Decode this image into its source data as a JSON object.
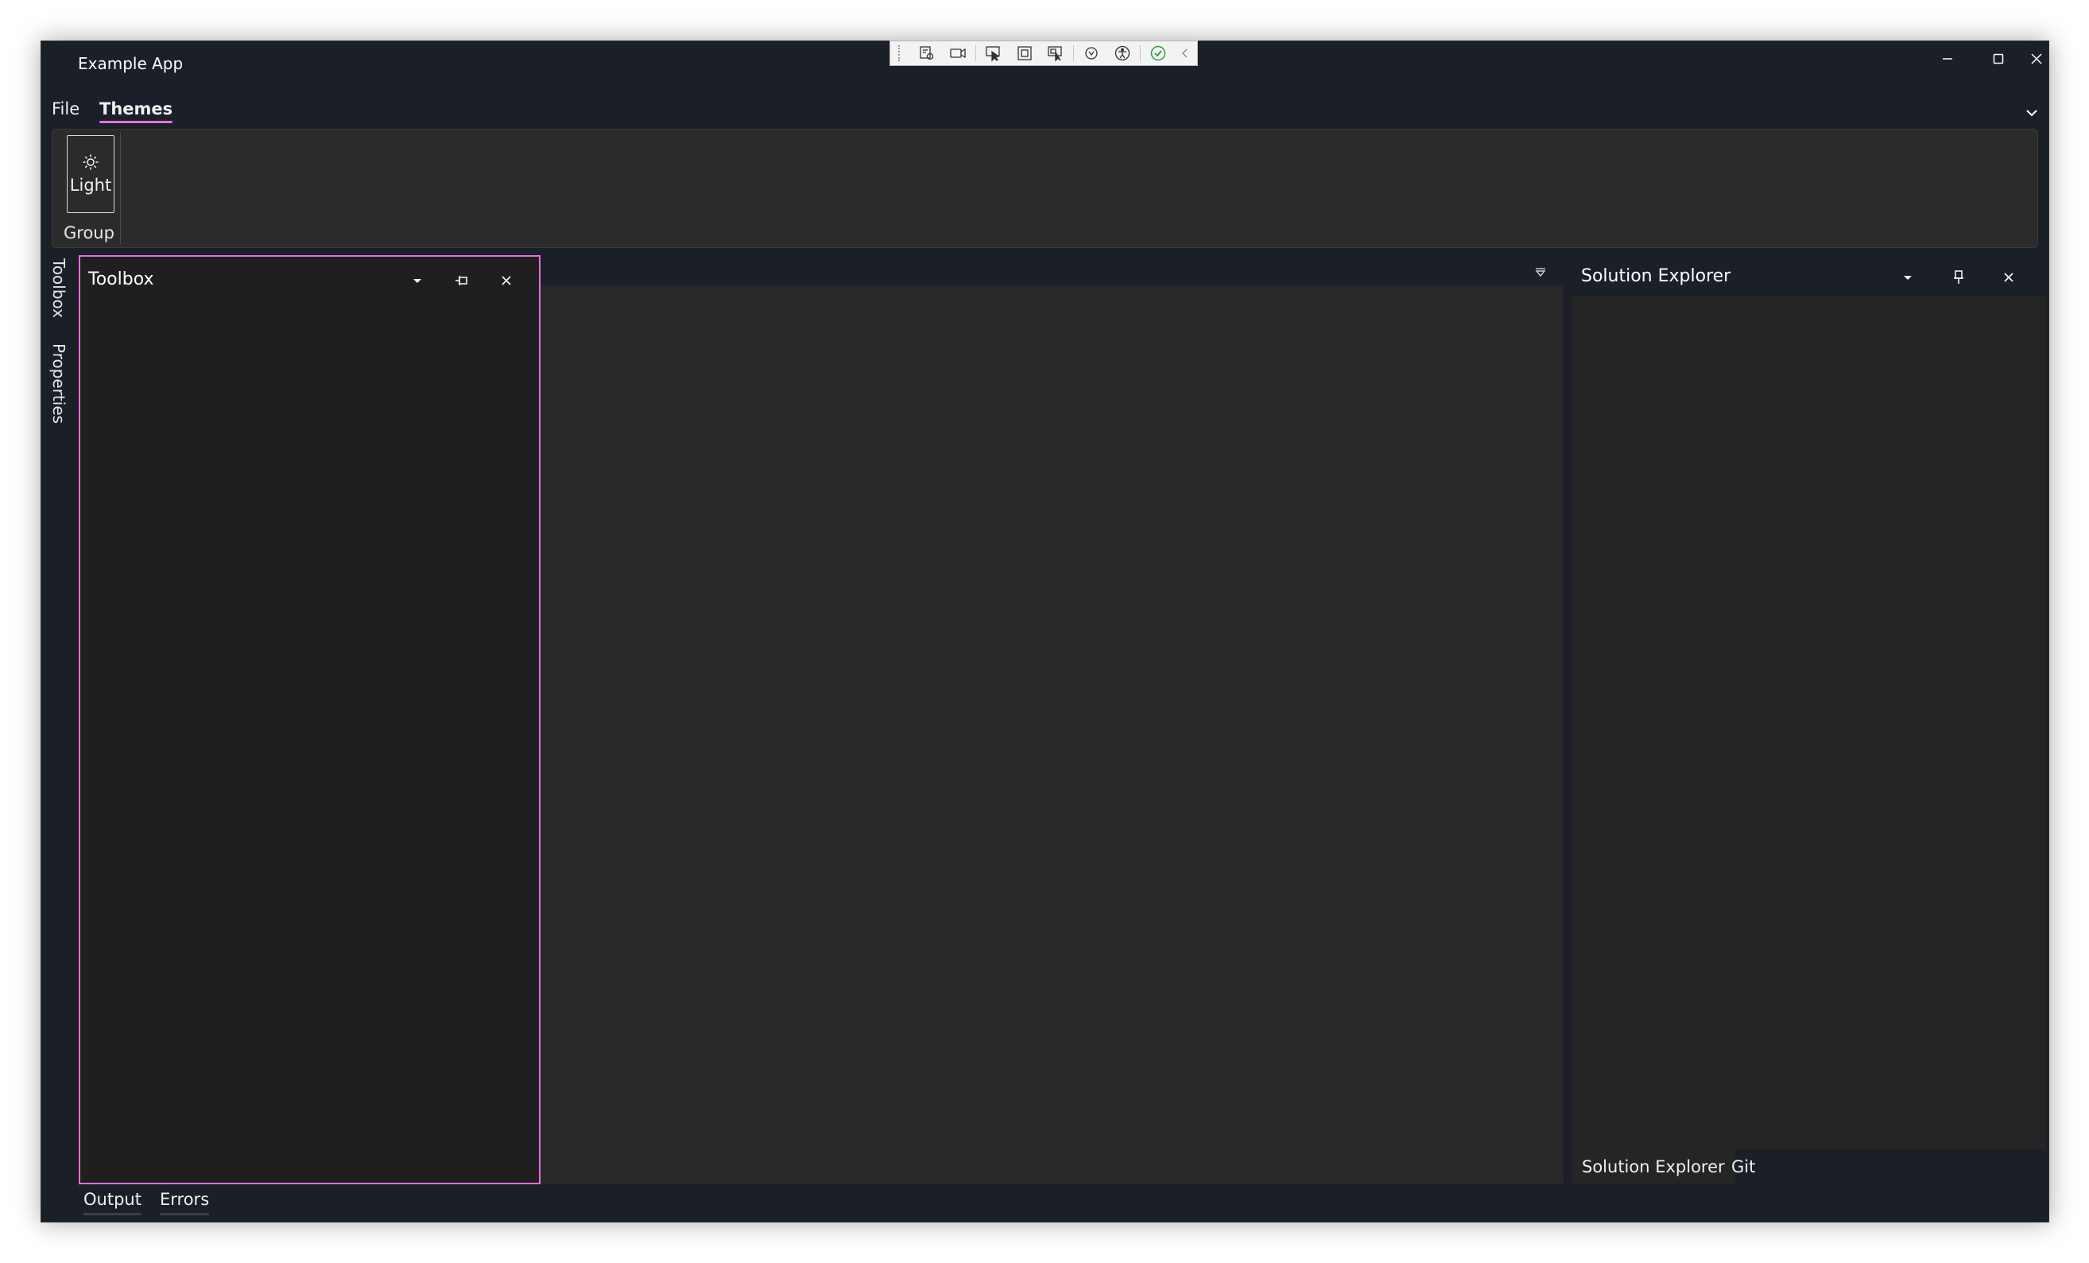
{
  "window": {
    "title": "Example App",
    "controls": [
      "minimize",
      "maximize",
      "close"
    ]
  },
  "debug_toolbar": {
    "icons": [
      "live-visual-tree-icon",
      "record-icon",
      "select-element-icon",
      "display-layout-adorners-icon",
      "track-focus-icon",
      "hot-reload-icon",
      "accessibility-icon",
      "checkmark-icon",
      "collapse-chevron-icon"
    ]
  },
  "menu": {
    "tabs": [
      {
        "label": "File",
        "active": false
      },
      {
        "label": "Themes",
        "active": true
      }
    ]
  },
  "ribbon": {
    "button_label": "Light",
    "button_icon": "sun-icon",
    "group_label": "Group"
  },
  "side_strip": {
    "tabs": [
      "Toolbox",
      "Properties"
    ]
  },
  "toolbox": {
    "title": "Toolbox"
  },
  "solution_explorer": {
    "title": "Solution Explorer",
    "tabs": [
      {
        "label": "Solution Explorer",
        "active": true
      },
      {
        "label": "Git",
        "active": false
      }
    ]
  },
  "bottom_tabs": [
    "Output",
    "Errors"
  ],
  "colors": {
    "accent": "#e86fdd",
    "window_bg": "#1b1f27",
    "panel_bg": "#1f1f1f",
    "document_bg": "#282828",
    "ribbon_bg": "#2b2b2b"
  }
}
